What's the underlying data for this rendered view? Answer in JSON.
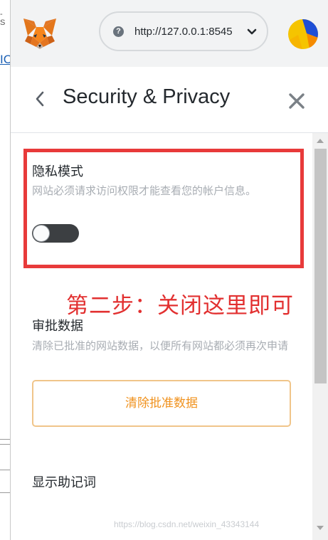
{
  "background": {
    "text": "- S",
    "link": "IC"
  },
  "topbar": {
    "network": {
      "help_icon": "?",
      "label": "http://127.0.0.1:8545"
    }
  },
  "header": {
    "title": "Security & Privacy"
  },
  "privacy_mode": {
    "title": "隐私模式",
    "description": "网站必须请求访问权限才能查看您的帐户信息。",
    "enabled": false
  },
  "annotation": "第二步：关闭这里即可",
  "approval_data": {
    "title": "审批数据",
    "description": "清除已批准的网站数据，以便所有网站都必须再次申请",
    "button_label": "清除批准数据"
  },
  "seed_phrase": {
    "title": "显示助记词"
  },
  "watermark": "https://blog.csdn.net/weixin_43343144",
  "colors": {
    "accent_orange": "#f0921e",
    "annotation_red": "#e83a3a",
    "toggle_off": "#3c3f42"
  },
  "icons": {
    "logo": "metamask-fox-icon",
    "back": "chevron-left-icon",
    "close": "close-icon",
    "network_dropdown": "chevron-down-icon"
  }
}
